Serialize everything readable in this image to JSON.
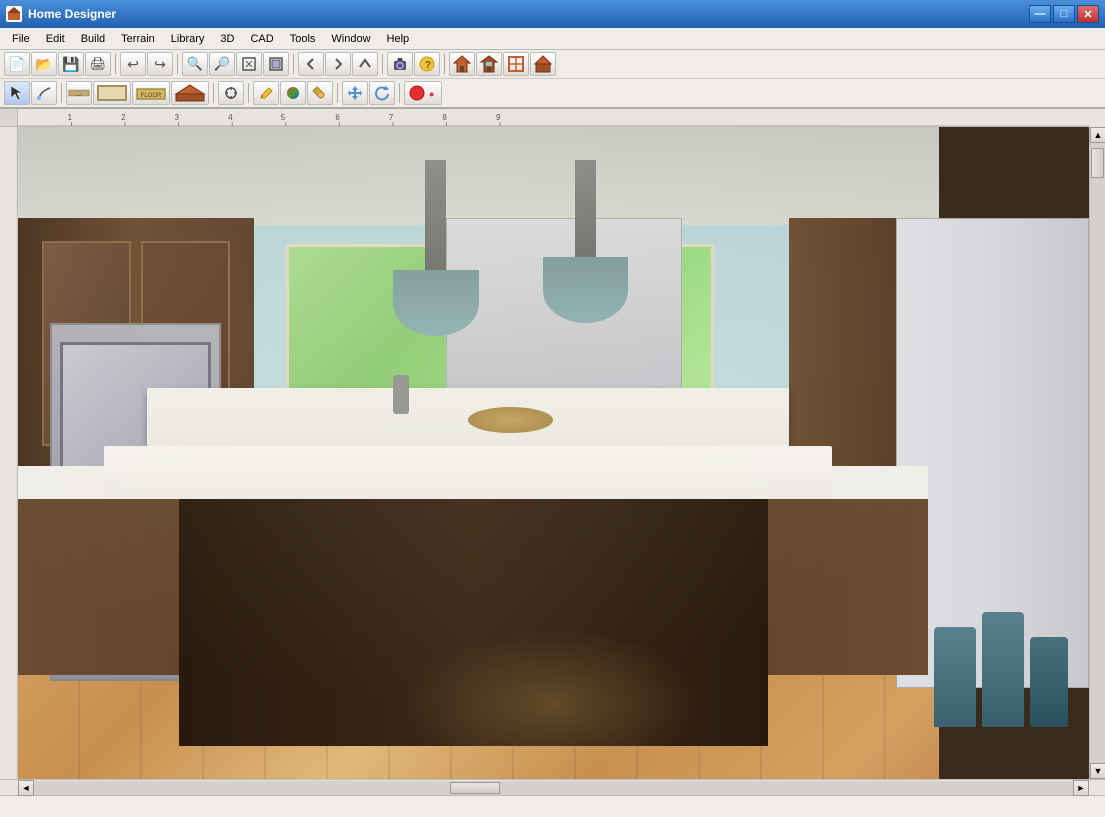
{
  "app": {
    "title": "Home Designer",
    "icon": "house"
  },
  "title_controls": {
    "minimize": "—",
    "maximize": "□",
    "close": "✕"
  },
  "menu": {
    "items": [
      {
        "id": "file",
        "label": "File"
      },
      {
        "id": "edit",
        "label": "Edit"
      },
      {
        "id": "build",
        "label": "Build"
      },
      {
        "id": "terrain",
        "label": "Terrain"
      },
      {
        "id": "library",
        "label": "Library"
      },
      {
        "id": "3d",
        "label": "3D"
      },
      {
        "id": "cad",
        "label": "CAD"
      },
      {
        "id": "tools",
        "label": "Tools"
      },
      {
        "id": "window",
        "label": "Window"
      },
      {
        "id": "help",
        "label": "Help"
      }
    ]
  },
  "toolbar1": {
    "buttons": [
      {
        "id": "new",
        "label": "New",
        "icon": "new-icon"
      },
      {
        "id": "open",
        "label": "Open",
        "icon": "open-icon"
      },
      {
        "id": "save",
        "label": "Save",
        "icon": "save-icon"
      },
      {
        "id": "print",
        "label": "Print",
        "icon": "print-icon"
      },
      {
        "id": "sep1",
        "type": "separator"
      },
      {
        "id": "undo",
        "label": "Undo",
        "icon": "undo-icon"
      },
      {
        "id": "redo",
        "label": "Redo",
        "icon": "redo-icon"
      },
      {
        "id": "sep2",
        "type": "separator"
      },
      {
        "id": "zoomin",
        "label": "Zoom In",
        "icon": "zoom-in-icon"
      },
      {
        "id": "zoomout",
        "label": "Zoom Out",
        "icon": "zoom-out-icon"
      },
      {
        "id": "zoom-fit",
        "label": "Fit",
        "icon": "zoom-fit-icon"
      },
      {
        "id": "zoom-full",
        "label": "Full",
        "icon": "zoom-full-icon"
      },
      {
        "id": "sep3",
        "type": "separator"
      },
      {
        "id": "back",
        "label": "Back",
        "icon": "back-icon"
      },
      {
        "id": "forward",
        "label": "Forward",
        "icon": "forward-icon"
      },
      {
        "id": "up",
        "label": "Up",
        "icon": "up-icon"
      },
      {
        "id": "sep4",
        "type": "separator"
      },
      {
        "id": "camera",
        "label": "Camera",
        "icon": "camera-icon"
      },
      {
        "id": "help",
        "label": "Help",
        "icon": "help-icon"
      },
      {
        "id": "sep5",
        "type": "separator"
      },
      {
        "id": "house1",
        "label": "House 1",
        "icon": "house1-icon"
      },
      {
        "id": "house2",
        "label": "House 2",
        "icon": "house2-icon"
      },
      {
        "id": "house3",
        "label": "House 3",
        "icon": "house3-icon"
      },
      {
        "id": "house4",
        "label": "House 4",
        "icon": "house4-icon"
      }
    ]
  },
  "toolbar2": {
    "buttons": [
      {
        "id": "select",
        "label": "Select",
        "icon": "select-icon"
      },
      {
        "id": "draw",
        "label": "Draw",
        "icon": "draw-icon"
      },
      {
        "id": "wall",
        "label": "Wall",
        "icon": "wall-icon"
      },
      {
        "id": "room",
        "label": "Room",
        "icon": "room-icon"
      },
      {
        "id": "floor",
        "label": "Floor",
        "icon": "floor-icon"
      },
      {
        "id": "roof",
        "label": "Roof",
        "icon": "roof-icon"
      },
      {
        "id": "snap",
        "label": "Snap",
        "icon": "snap-icon"
      },
      {
        "id": "sep1",
        "type": "separator"
      },
      {
        "id": "pencil",
        "label": "Pencil",
        "icon": "pencil-icon"
      },
      {
        "id": "material",
        "label": "Material",
        "icon": "material-icon"
      },
      {
        "id": "paint",
        "label": "Paint",
        "icon": "paint-icon"
      },
      {
        "id": "sep2",
        "type": "separator"
      },
      {
        "id": "move",
        "label": "Move",
        "icon": "move-icon"
      },
      {
        "id": "rotate",
        "label": "Rotate",
        "icon": "rotate-icon"
      },
      {
        "id": "sep3",
        "type": "separator"
      },
      {
        "id": "record",
        "label": "Record",
        "icon": "record-icon"
      }
    ]
  },
  "status_bar": {
    "text": ""
  },
  "scrollbar": {
    "up_arrow": "▲",
    "down_arrow": "▼",
    "left_arrow": "◄",
    "right_arrow": "►"
  }
}
